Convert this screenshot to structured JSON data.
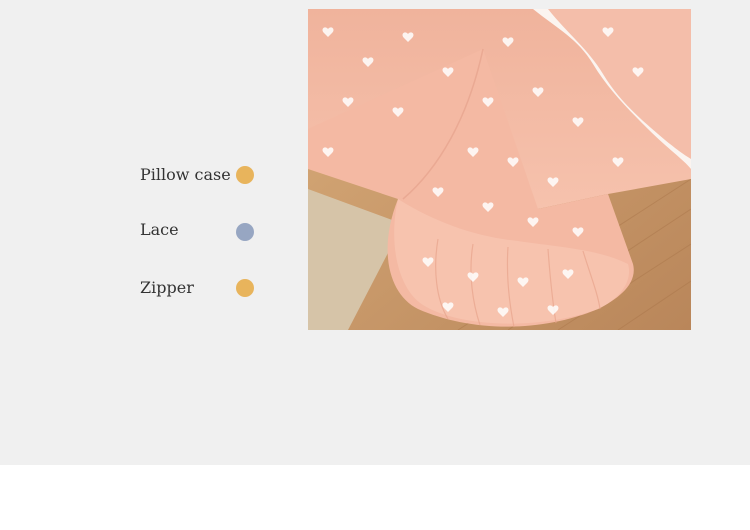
{
  "legend": {
    "items": [
      {
        "label": "Pillow case",
        "dot_color": "#e8b45c"
      },
      {
        "label": "Lace",
        "dot_color": "#97a6c2"
      },
      {
        "label": "Zipper",
        "dot_color": "#e8b45c"
      }
    ]
  },
  "photo": {
    "subject": "Peach bed sheet with white heart print and ruffle corner",
    "fabric_color": "#f3b8a2",
    "ruffle_color": "#fbf4f0",
    "floor_color": "#c99a67",
    "rug_color": "#d9c7ae"
  }
}
